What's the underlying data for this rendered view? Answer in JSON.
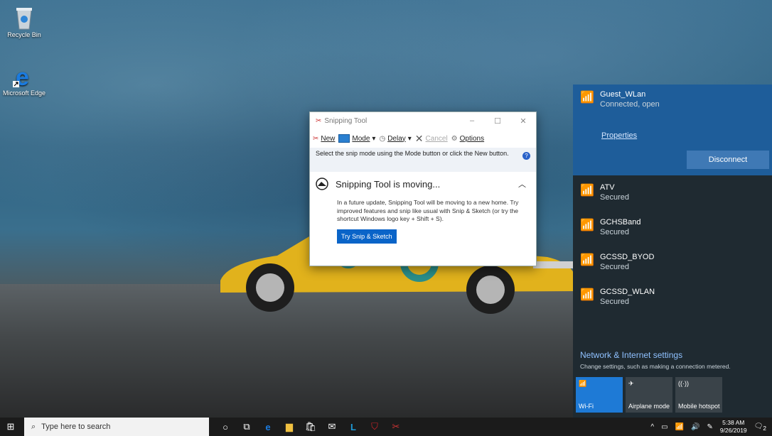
{
  "desktop_icons": [
    {
      "label": "Recycle Bin",
      "icon": "recycle-bin-icon"
    },
    {
      "label": "Microsoft Edge",
      "icon": "edge-icon"
    }
  ],
  "snipping_tool": {
    "title": "Snipping Tool",
    "toolbar": {
      "new": "New",
      "mode": "Mode",
      "delay": "Delay",
      "cancel": "Cancel",
      "options": "Options"
    },
    "hint": "Select the snip mode using the Mode button or click the New button.",
    "moving_title": "Snipping Tool is moving...",
    "moving_body": "In a future update, Snipping Tool will be moving to a new home. Try improved features and snip like usual with Snip & Sketch (or try the shortcut Windows logo key + Shift + S).",
    "try_button": "Try Snip & Sketch"
  },
  "network": {
    "active": {
      "name": "Guest_WLan",
      "status": "Connected, open",
      "properties": "Properties",
      "disconnect": "Disconnect"
    },
    "list": [
      {
        "name": "ATV",
        "status": "Secured"
      },
      {
        "name": "GCHSBand",
        "status": "Secured"
      },
      {
        "name": "GCSSD_BYOD",
        "status": "Secured"
      },
      {
        "name": "GCSSD_WLAN",
        "status": "Secured"
      }
    ],
    "settings_link": "Network & Internet settings",
    "settings_sub": "Change settings, such as making a connection metered.",
    "tiles": [
      {
        "label": "Wi-Fi",
        "active": true
      },
      {
        "label": "Airplane mode",
        "active": false
      },
      {
        "label": "Mobile hotspot",
        "active": false
      }
    ]
  },
  "taskbar": {
    "search_placeholder": "Type here to search",
    "time": "5:38 AM",
    "date": "9/26/2019",
    "notification_count": "2"
  }
}
